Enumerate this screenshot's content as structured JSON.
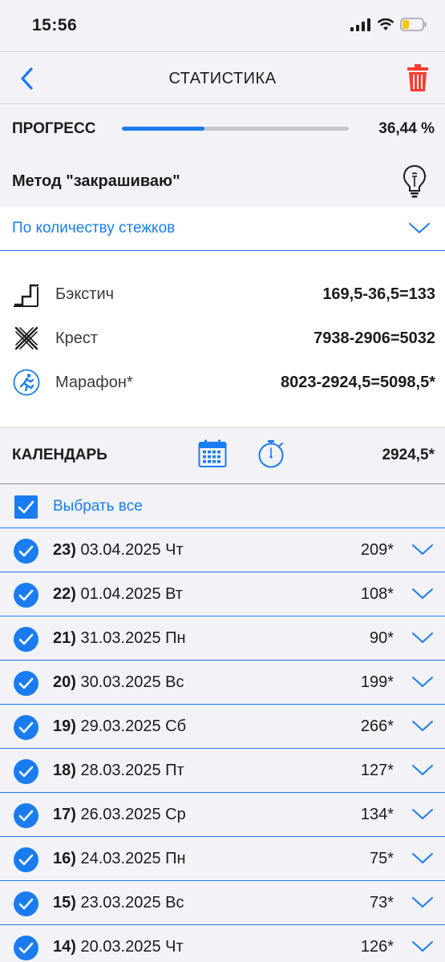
{
  "status_bar": {
    "time": "15:56"
  },
  "nav": {
    "title": "СТАТИСТИКА"
  },
  "progress": {
    "label": "ПРОГРЕСС",
    "value_text": "36,44 %",
    "fraction": 0.3644
  },
  "method": {
    "label": "Метод \"закрашиваю\""
  },
  "count_mode": {
    "selected": "По количеству стежков"
  },
  "stats": [
    {
      "icon": "backstitch-icon",
      "name": "Бэкстич",
      "value": "169,5-36,5=133"
    },
    {
      "icon": "cross-stitch-icon",
      "name": "Крест",
      "value": "7938-2906=5032"
    },
    {
      "icon": "marathon-runner-icon",
      "name": "Марафон*",
      "value": "8023-2924,5=5098,5*"
    }
  ],
  "calendar": {
    "label": "КАЛЕНДАРЬ",
    "total": "2924,5*"
  },
  "select_all": {
    "label": "Выбрать все"
  },
  "days": [
    {
      "num": "23)",
      "date": "03.04.2025 Чт",
      "count": "209*"
    },
    {
      "num": "22)",
      "date": "01.04.2025 Вт",
      "count": "108*"
    },
    {
      "num": "21)",
      "date": "31.03.2025 Пн",
      "count": "90*"
    },
    {
      "num": "20)",
      "date": "30.03.2025 Вс",
      "count": "199*"
    },
    {
      "num": "19)",
      "date": "29.03.2025 Сб",
      "count": "266*"
    },
    {
      "num": "18)",
      "date": "28.03.2025 Пт",
      "count": "127*"
    },
    {
      "num": "17)",
      "date": "26.03.2025 Ср",
      "count": "134*"
    },
    {
      "num": "16)",
      "date": "24.03.2025 Пн",
      "count": "75*"
    },
    {
      "num": "15)",
      "date": "23.03.2025 Вс",
      "count": "73*"
    },
    {
      "num": "14)",
      "date": "20.03.2025 Чт",
      "count": "126*"
    }
  ],
  "colors": {
    "accent": "#1a7cf0",
    "danger": "#ff3b30",
    "background": "#f2f2f7"
  }
}
